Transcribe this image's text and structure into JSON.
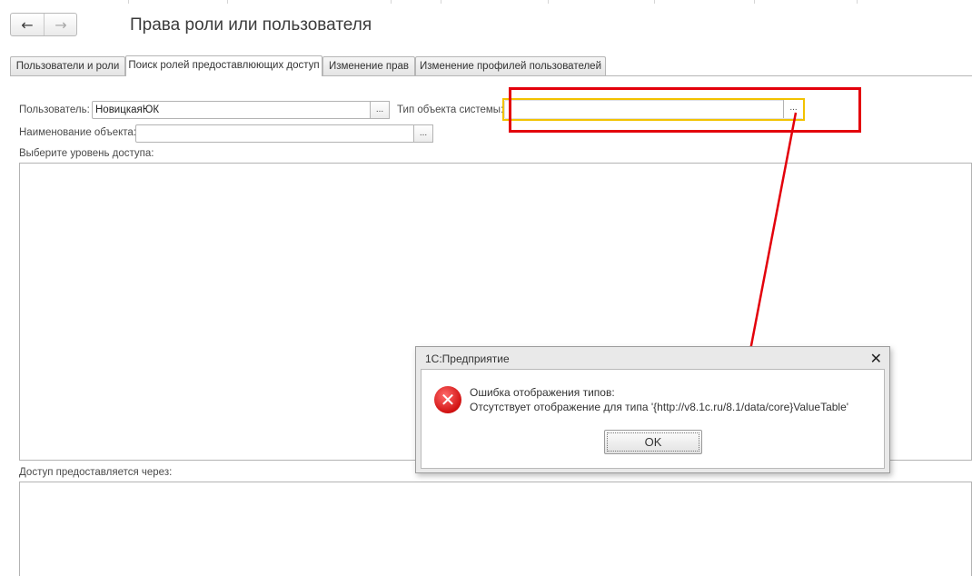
{
  "window": {
    "title": "Права роли или пользователя"
  },
  "nav": {
    "back_icon": "←",
    "forward_icon": "→"
  },
  "tabs": [
    {
      "label": "Пользователи и роли",
      "active": false
    },
    {
      "label": "Поиск ролей предоставлюющих доступ",
      "active": true
    },
    {
      "label": "Изменение прав",
      "active": false
    },
    {
      "label": "Изменение профилей пользователей",
      "active": false
    }
  ],
  "form": {
    "user_label": "Пользователь:",
    "user_value": "НовицкаяЮК",
    "system_object_type_label": "Тип объекта системы:",
    "system_object_type_value": "",
    "object_name_label": "Наименование объекта:",
    "object_name_value": "",
    "select_button": "...",
    "access_level_label": "Выберите уровень доступа:",
    "access_through_label": "Доступ предоставляется через:"
  },
  "dialog": {
    "title": "1С:Предприятие",
    "close_icon": "✕",
    "error_icon": "✕",
    "message_line1": "Ошибка отображения типов:",
    "message_line2": "Отсутствует отображение для типа '{http://v8.1c.ru/8.1/data/core}ValueTable'",
    "ok_label": "OK"
  },
  "annotation": {
    "highlight_color": "#e3000b",
    "focus_color": "#f2c200"
  }
}
